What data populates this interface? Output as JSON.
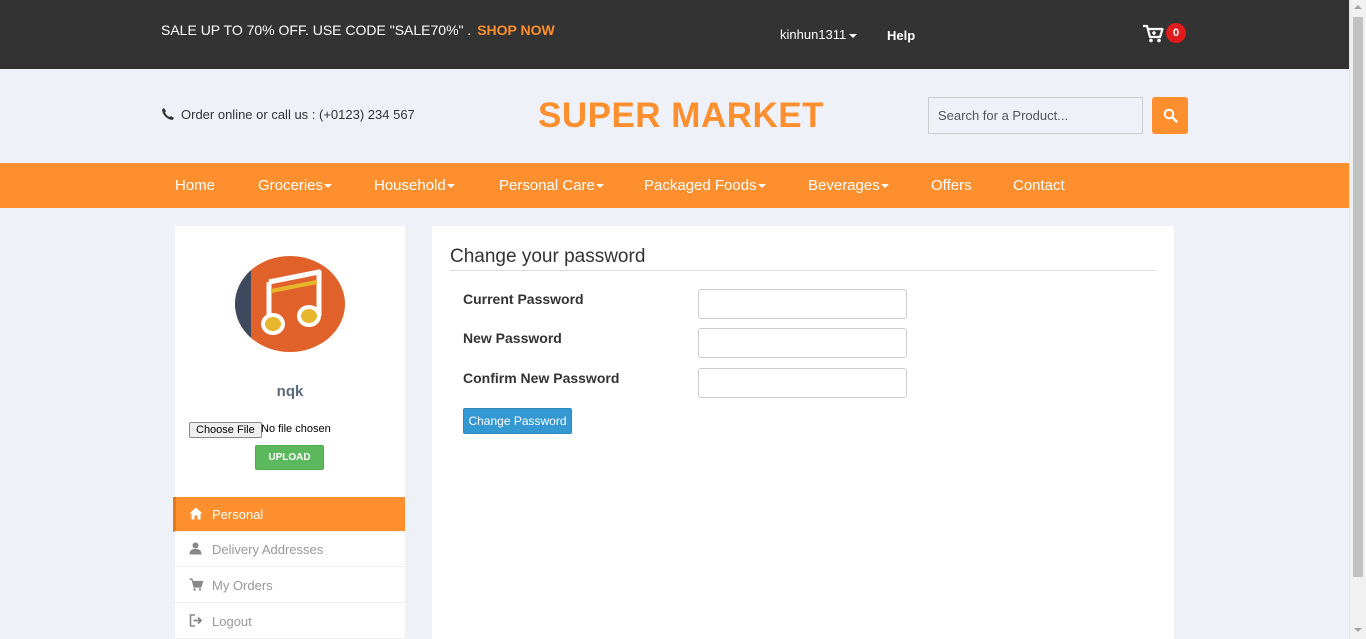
{
  "topbar": {
    "promo_text": "SALE UP TO 70% OFF. USE CODE \"SALE70%\" .",
    "promo_link": "SHOP NOW",
    "username": "kinhun1311",
    "help": "Help",
    "cart_count": "0"
  },
  "header": {
    "phone_text": "Order online or call us : (+0123) 234 567",
    "brand": "SUPER MARKET",
    "search_placeholder": "Search for a Product..."
  },
  "nav": {
    "items": [
      {
        "label": "Home",
        "dropdown": false
      },
      {
        "label": "Groceries",
        "dropdown": true
      },
      {
        "label": "Household",
        "dropdown": true
      },
      {
        "label": "Personal Care",
        "dropdown": true
      },
      {
        "label": "Packaged Foods",
        "dropdown": true
      },
      {
        "label": "Beverages",
        "dropdown": true
      },
      {
        "label": "Offers",
        "dropdown": false
      },
      {
        "label": "Contact",
        "dropdown": false
      }
    ]
  },
  "sidebar": {
    "username": "nqk",
    "choose_file": "Choose File",
    "no_file": "No file chosen",
    "upload": "UPLOAD",
    "menu": [
      {
        "label": "Personal",
        "icon": "home-icon",
        "active": true
      },
      {
        "label": "Delivery Addresses",
        "icon": "user-icon",
        "active": false
      },
      {
        "label": "My Orders",
        "icon": "cart-icon",
        "active": false
      },
      {
        "label": "Logout",
        "icon": "logout-icon",
        "active": false
      }
    ]
  },
  "panel": {
    "title": "Change your password",
    "fields": [
      {
        "label": "Current Password",
        "value": ""
      },
      {
        "label": "New Password",
        "value": ""
      },
      {
        "label": "Confirm New Password",
        "value": ""
      }
    ],
    "submit": "Change Password"
  },
  "colors": {
    "accent": "#fd8f2e",
    "topbar_bg": "#333333",
    "page_bg": "#eef1f8",
    "upload_green": "#5cb85c",
    "button_blue": "#3498d3",
    "badge_red": "#e01b1b"
  }
}
